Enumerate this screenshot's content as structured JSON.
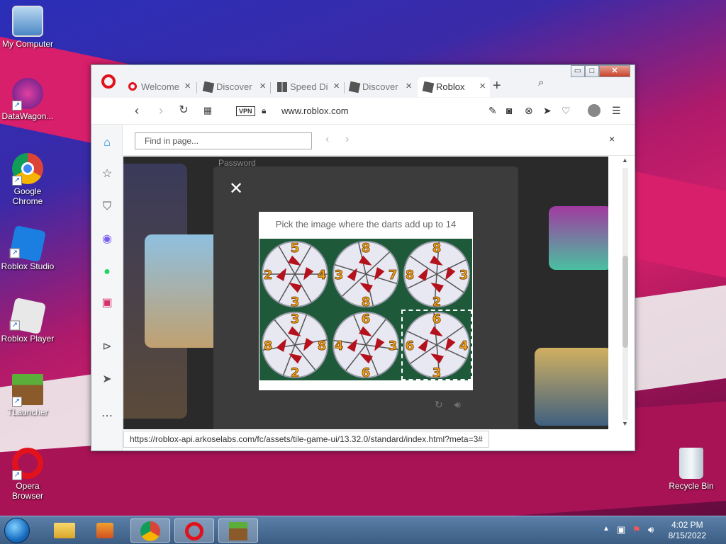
{
  "desktop": {
    "icons": [
      {
        "label": "My Computer",
        "icon": "computer-icon"
      },
      {
        "label": "DataWagon...",
        "icon": "datawagon-icon"
      },
      {
        "label": "Google Chrome",
        "icon": "chrome-icon"
      },
      {
        "label": "Roblox Studio",
        "icon": "roblox-studio-icon"
      },
      {
        "label": "Roblox Player",
        "icon": "roblox-player-icon"
      },
      {
        "label": "TLauncher",
        "icon": "minecraft-icon"
      },
      {
        "label": "Opera Browser",
        "icon": "opera-icon"
      },
      {
        "label": "Recycle Bin",
        "icon": "recycle-bin-icon"
      }
    ]
  },
  "browser": {
    "tabs": [
      {
        "label": "Welcome",
        "icon": "opera-icon"
      },
      {
        "label": "Discover",
        "icon": "roblox-icon"
      },
      {
        "label": "Speed Di",
        "icon": "speed-dial-icon"
      },
      {
        "label": "Discover",
        "icon": "roblox-icon"
      },
      {
        "label": "Roblox",
        "icon": "roblox-icon"
      }
    ],
    "window_buttons": {
      "minimize": "▭",
      "maximize": "□",
      "close": "✕"
    },
    "vpn_label": "VPN",
    "url": "www.roblox.com",
    "find": {
      "placeholder": "Find in page..."
    },
    "page": {
      "password_label": "Password",
      "captcha": {
        "question": "Pick the image where the darts add up to 14",
        "tiles": [
          {
            "numbers": [
              "5",
              "4",
              "2",
              "3"
            ]
          },
          {
            "numbers": [
              "8",
              "7",
              "3",
              "8"
            ]
          },
          {
            "numbers": [
              "8",
              "3",
              "8",
              "2"
            ]
          },
          {
            "numbers": [
              "3",
              "8",
              "8",
              "2"
            ]
          },
          {
            "numbers": [
              "6",
              "3",
              "4",
              "6"
            ]
          },
          {
            "numbers": [
              "6",
              "4",
              "6",
              "3"
            ]
          }
        ],
        "selected_tile": 5
      }
    },
    "status_url": "https://roblox-api.arkoselabs.com/fc/assets/tile-game-ui/13.32.0/standard/index.html?meta=3#"
  },
  "taskbar": {
    "clock_time": "4:02 PM",
    "clock_date": "8/15/2022"
  },
  "colors": {
    "opera_red": "#e2121c",
    "tile_green": "#1e5a3a",
    "dart_red": "#b3121c",
    "number_gold": "#f0a21a"
  }
}
